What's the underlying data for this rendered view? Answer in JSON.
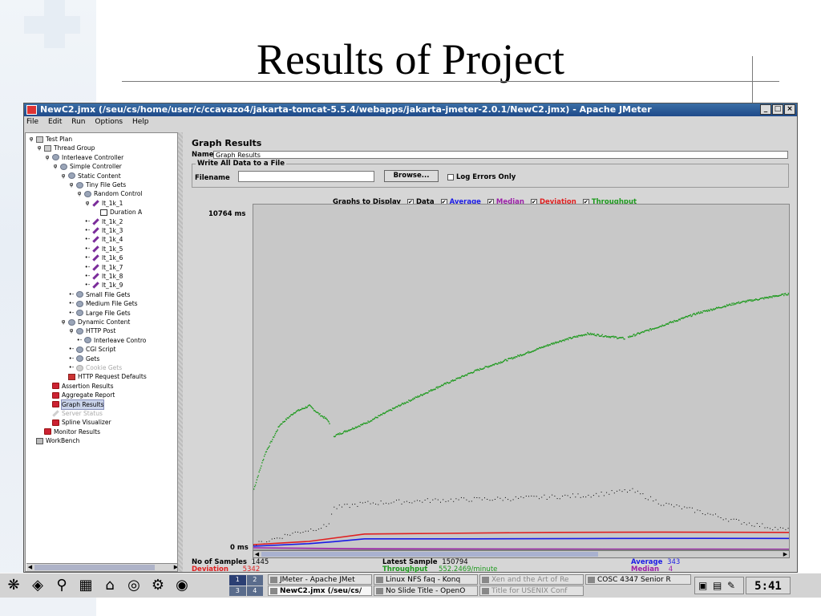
{
  "slide": {
    "title": "Results of Project"
  },
  "window": {
    "title": "NewC2.jmx (/seu/cs/home/user/c/ccavazo4/jakarta-tomcat-5.5.4/webapps/jakarta-jmeter-2.0.1/NewC2.jmx) - Apache JMeter",
    "controls": [
      "_",
      "□",
      "×"
    ]
  },
  "menu": [
    "File",
    "Edit",
    "Run",
    "Options",
    "Help"
  ],
  "tree": [
    {
      "label": "Test Plan",
      "depth": 0,
      "toggle": "φ",
      "icon": "plan"
    },
    {
      "label": "Thread Group",
      "depth": 1,
      "toggle": "φ",
      "icon": "plan"
    },
    {
      "label": "Interleave Controller",
      "depth": 2,
      "toggle": "φ",
      "icon": "controller"
    },
    {
      "label": "Simple Controller",
      "depth": 3,
      "toggle": "φ",
      "icon": "controller"
    },
    {
      "label": "Static Content",
      "depth": 4,
      "toggle": "φ",
      "icon": "controller"
    },
    {
      "label": "Tiny File Gets",
      "depth": 5,
      "toggle": "φ",
      "icon": "controller"
    },
    {
      "label": "Random Control",
      "depth": 6,
      "toggle": "φ",
      "icon": "controller"
    },
    {
      "label": "lt_1k_1",
      "depth": 7,
      "toggle": "φ",
      "icon": "sampler"
    },
    {
      "label": "Duration A",
      "depth": 8,
      "toggle": "",
      "icon": "doc"
    },
    {
      "label": "lt_1k_2",
      "depth": 7,
      "toggle": "•-",
      "icon": "sampler"
    },
    {
      "label": "lt_1k_3",
      "depth": 7,
      "toggle": "•-",
      "icon": "sampler"
    },
    {
      "label": "lt_1k_4",
      "depth": 7,
      "toggle": "•-",
      "icon": "sampler"
    },
    {
      "label": "lt_1k_5",
      "depth": 7,
      "toggle": "•-",
      "icon": "sampler"
    },
    {
      "label": "lt_1k_6",
      "depth": 7,
      "toggle": "•-",
      "icon": "sampler"
    },
    {
      "label": "lt_1k_7",
      "depth": 7,
      "toggle": "•-",
      "icon": "sampler"
    },
    {
      "label": "lt_1k_8",
      "depth": 7,
      "toggle": "•-",
      "icon": "sampler"
    },
    {
      "label": "lt_1k_9",
      "depth": 7,
      "toggle": "•-",
      "icon": "sampler"
    },
    {
      "label": "Small File Gets",
      "depth": 5,
      "toggle": "•-",
      "icon": "controller"
    },
    {
      "label": "Medium File Gets",
      "depth": 5,
      "toggle": "•-",
      "icon": "controller"
    },
    {
      "label": "Large File Gets",
      "depth": 5,
      "toggle": "•-",
      "icon": "controller"
    },
    {
      "label": "Dynamic Content",
      "depth": 4,
      "toggle": "φ",
      "icon": "controller"
    },
    {
      "label": "HTTP Post",
      "depth": 5,
      "toggle": "φ",
      "icon": "controller"
    },
    {
      "label": "Interleave Contro",
      "depth": 6,
      "toggle": "•-",
      "icon": "controller"
    },
    {
      "label": "CGI Script",
      "depth": 5,
      "toggle": "•-",
      "icon": "controller"
    },
    {
      "label": "Gets",
      "depth": 5,
      "toggle": "•-",
      "icon": "controller"
    },
    {
      "label": "Cookie Gets",
      "depth": 5,
      "toggle": "•-",
      "icon": "controller",
      "disabled": true
    },
    {
      "label": "HTTP Request Defaults",
      "depth": 4,
      "toggle": "",
      "icon": "config"
    },
    {
      "label": "Assertion Results",
      "depth": 2,
      "toggle": "",
      "icon": "listener"
    },
    {
      "label": "Aggregate Report",
      "depth": 2,
      "toggle": "",
      "icon": "listener"
    },
    {
      "label": "Graph Results",
      "depth": 2,
      "toggle": "",
      "icon": "listener",
      "selected": true
    },
    {
      "label": "Server Status",
      "depth": 2,
      "toggle": "",
      "icon": "sampler",
      "disabled": true
    },
    {
      "label": "Spline Visualizer",
      "depth": 2,
      "toggle": "",
      "icon": "listener"
    },
    {
      "label": "Monitor Results",
      "depth": 1,
      "toggle": "",
      "icon": "listener"
    },
    {
      "label": "WorkBench",
      "depth": 0,
      "toggle": "",
      "icon": "bench"
    }
  ],
  "panel": {
    "title": "Graph Results",
    "name_label": "Name:",
    "name_value": "Graph Results",
    "write_group": "Write All Data to a File",
    "filename_label": "Filename",
    "filename_value": "",
    "browse_label": "Browse...",
    "log_errors_label": "Log Errors Only",
    "graphs_label": "Graphs to Display",
    "graphs": [
      {
        "label": "Data",
        "color": "#000000",
        "checked": true
      },
      {
        "label": "Average",
        "color": "#1a1ae6",
        "checked": true
      },
      {
        "label": "Median",
        "color": "#9b1fa8",
        "checked": true
      },
      {
        "label": "Deviation",
        "color": "#e02020",
        "checked": true
      },
      {
        "label": "Throughput",
        "color": "#1e9a1e",
        "checked": true
      }
    ],
    "y_max_label": "10764 ms",
    "y_min_label": "0 ms"
  },
  "chart_data": {
    "type": "scatter",
    "y_range_ms": [
      0,
      10764
    ],
    "x_samples": [
      0,
      1445
    ],
    "series": [
      {
        "name": "Throughput",
        "color": "#1e9a1e",
        "points": [
          [
            0,
            1900
          ],
          [
            30,
            3000
          ],
          [
            70,
            3900
          ],
          [
            110,
            4300
          ],
          [
            150,
            4500
          ],
          [
            175,
            4250
          ],
          [
            200,
            4050
          ],
          [
            215,
            3550
          ],
          [
            300,
            3950
          ],
          [
            400,
            4550
          ],
          [
            500,
            5100
          ],
          [
            600,
            5600
          ],
          [
            700,
            6000
          ],
          [
            820,
            6500
          ],
          [
            900,
            6750
          ],
          [
            1000,
            6600
          ],
          [
            1100,
            7000
          ],
          [
            1200,
            7400
          ],
          [
            1300,
            7700
          ],
          [
            1445,
            8000
          ]
        ]
      },
      {
        "name": "Data",
        "color": "#000000",
        "points": [
          [
            0,
            150
          ],
          [
            100,
            500
          ],
          [
            200,
            750
          ],
          [
            215,
            1300
          ],
          [
            300,
            1450
          ],
          [
            500,
            1550
          ],
          [
            700,
            1600
          ],
          [
            900,
            1700
          ],
          [
            1020,
            1850
          ],
          [
            1100,
            1450
          ],
          [
            1200,
            1200
          ],
          [
            1300,
            900
          ],
          [
            1445,
            600
          ]
        ]
      },
      {
        "name": "Deviation",
        "color": "#e02020",
        "points": [
          [
            0,
            150
          ],
          [
            150,
            250
          ],
          [
            215,
            350
          ],
          [
            300,
            480
          ],
          [
            500,
            500
          ],
          [
            800,
            530
          ],
          [
            1100,
            540
          ],
          [
            1445,
            530
          ]
        ]
      },
      {
        "name": "Average",
        "color": "#1a1ae6",
        "points": [
          [
            0,
            100
          ],
          [
            150,
            180
          ],
          [
            215,
            240
          ],
          [
            300,
            330
          ],
          [
            600,
            330
          ],
          [
            900,
            340
          ],
          [
            1200,
            345
          ],
          [
            1445,
            343
          ]
        ]
      },
      {
        "name": "Median",
        "color": "#9b1fa8",
        "points": [
          [
            0,
            50
          ],
          [
            300,
            20
          ],
          [
            800,
            10
          ],
          [
            1445,
            4
          ]
        ]
      }
    ]
  },
  "stats": {
    "no_samples_label": "No of Samples",
    "no_samples_value": "1445",
    "latest_label": "Latest Sample",
    "latest_value": "150794",
    "average_label": "Average",
    "average_value": "343",
    "deviation_label": "Deviation",
    "deviation_value": "5342",
    "throughput_label": "Throughput",
    "throughput_value": "552.2469/minute",
    "median_label": "Median",
    "median_value": "4"
  },
  "taskbar": {
    "desktops": [
      "1",
      "2",
      "3",
      "4"
    ],
    "tasks": [
      {
        "label": "JMeter - Apache JMet",
        "state": "normal"
      },
      {
        "label": "Linux NFS faq - Konq",
        "state": "normal"
      },
      {
        "label": "Xen and the Art of Re",
        "state": "inactive"
      },
      {
        "label": "COSC 4347 Senior R",
        "state": "normal"
      },
      {
        "label": "NewC2.jmx (/seu/cs/",
        "state": "active"
      },
      {
        "label": "No Slide Title - OpenO",
        "state": "normal"
      },
      {
        "label": "Title for USENIX Conf",
        "state": "inactive"
      }
    ],
    "clock": "5:41"
  }
}
